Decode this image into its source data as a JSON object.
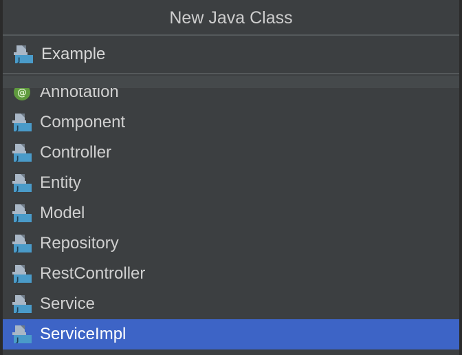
{
  "dialog": {
    "title": "New Java Class",
    "class_name": "Example"
  },
  "templates": [
    {
      "label": "Annotation",
      "icon": "annotation-icon"
    },
    {
      "label": "Component",
      "icon": "java-class-icon"
    },
    {
      "label": "Controller",
      "icon": "java-class-icon"
    },
    {
      "label": "Entity",
      "icon": "java-class-icon"
    },
    {
      "label": "Model",
      "icon": "java-class-icon"
    },
    {
      "label": "Repository",
      "icon": "java-class-icon"
    },
    {
      "label": "RestController",
      "icon": "java-class-icon"
    },
    {
      "label": "Service",
      "icon": "java-class-icon"
    },
    {
      "label": "ServiceImpl",
      "icon": "java-class-icon"
    }
  ],
  "selected_template": "ServiceImpl",
  "colors": {
    "background": "#3c3f41",
    "selection": "#3d64c6",
    "java_icon_blue": "#4a9bc9",
    "annotation_green": "#5f9a3e"
  }
}
